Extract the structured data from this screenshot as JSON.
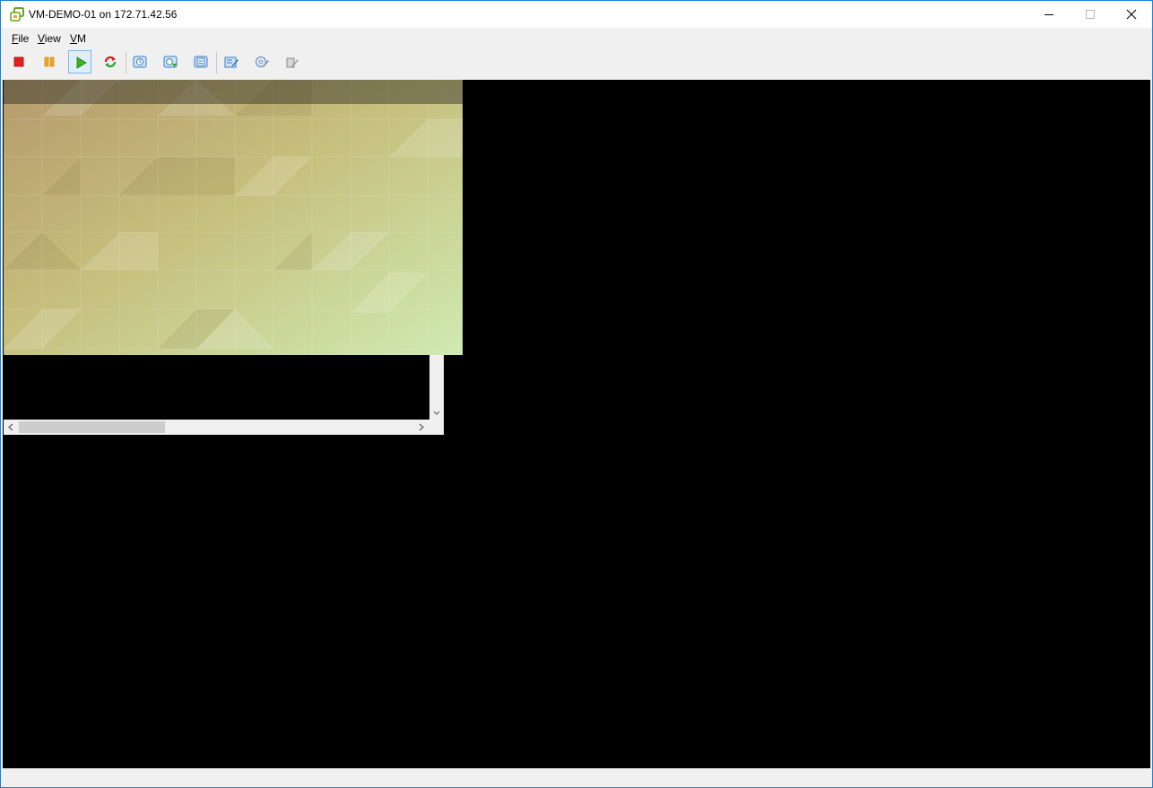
{
  "window": {
    "title": "VM-DEMO-01 on 172.71.42.56"
  },
  "menu": {
    "file_label": "File",
    "view_label": "View",
    "vm_label": "VM"
  },
  "toolbar": {
    "buttons": [
      {
        "name": "power-off",
        "icon": "red-square-stop-icon"
      },
      {
        "name": "suspend",
        "icon": "orange-pause-icon"
      },
      {
        "name": "power-on",
        "icon": "green-play-icon",
        "active": true
      },
      {
        "name": "reset",
        "icon": "red-green-refresh-icon"
      },
      {
        "name": "take-snapshot",
        "icon": "snapshot-icon"
      },
      {
        "name": "revert-snapshot",
        "icon": "snapshot-revert-icon"
      },
      {
        "name": "snapshot-manager",
        "icon": "snapshot-manager-icon"
      },
      {
        "name": "edit-settings",
        "icon": "edit-settings-icon"
      },
      {
        "name": "cd-dvd",
        "icon": "cd-dvd-icon"
      },
      {
        "name": "floppy",
        "icon": "connect-device-icon",
        "disabled": true
      }
    ]
  },
  "colors": {
    "accent_border": "#1883d7",
    "console_bg": "#000000",
    "chrome_bg": "#f0f0f0"
  }
}
